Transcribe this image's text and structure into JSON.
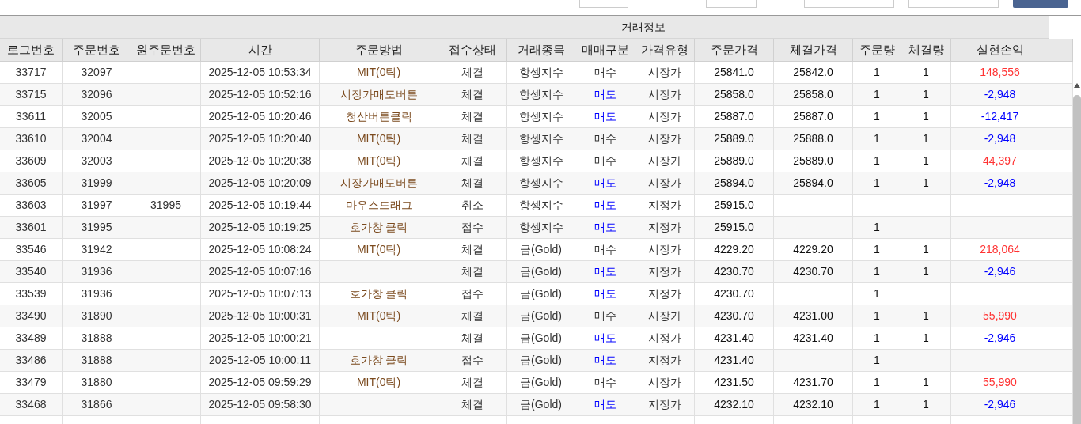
{
  "group_header": "거래정보",
  "columns": [
    "로그번호",
    "주문번호",
    "원주문번호",
    "시간",
    "주문방법",
    "접수상태",
    "거래종목",
    "매매구분",
    "가격유형",
    "주문가격",
    "체결가격",
    "주문량",
    "체결량",
    "실현손익"
  ],
  "rows": [
    {
      "cells": [
        "33717",
        "32097",
        null,
        "2025-12-05 10:53:34",
        "MIT(0틱)",
        "체결",
        "항셍지수",
        {
          "text": "매수",
          "color": "#333333"
        },
        "시장가",
        "25841.0",
        "25842.0",
        "1",
        "1",
        {
          "text": "148,556",
          "color": "#ff3333"
        }
      ]
    },
    {
      "cells": [
        "33715",
        "32096",
        null,
        "2025-12-05 10:52:16",
        "시장가매도버튼",
        "체결",
        "항셍지수",
        {
          "text": "매도",
          "color": "#0000ff"
        },
        "시장가",
        "25858.0",
        "25858.0",
        "1",
        "1",
        {
          "text": "-2,948",
          "color": "#0000ff"
        }
      ]
    },
    {
      "cells": [
        "33611",
        "32005",
        null,
        "2025-12-05 10:20:46",
        "청산버튼클릭",
        "체결",
        "항셍지수",
        {
          "text": "매도",
          "color": "#0000ff"
        },
        "시장가",
        "25887.0",
        "25887.0",
        "1",
        "1",
        {
          "text": "-12,417",
          "color": "#0000ff"
        }
      ]
    },
    {
      "cells": [
        "33610",
        "32004",
        null,
        "2025-12-05 10:20:40",
        "MIT(0틱)",
        "체결",
        "항셍지수",
        {
          "text": "매수",
          "color": "#333333"
        },
        "시장가",
        "25889.0",
        "25888.0",
        "1",
        "1",
        {
          "text": "-2,948",
          "color": "#0000ff"
        }
      ]
    },
    {
      "cells": [
        "33609",
        "32003",
        null,
        "2025-12-05 10:20:38",
        "MIT(0틱)",
        "체결",
        "항셍지수",
        {
          "text": "매수",
          "color": "#333333"
        },
        "시장가",
        "25889.0",
        "25889.0",
        "1",
        "1",
        {
          "text": "44,397",
          "color": "#ff3333"
        }
      ]
    },
    {
      "cells": [
        "33605",
        "31999",
        null,
        "2025-12-05 10:20:09",
        "시장가매도버튼",
        "체결",
        "항셍지수",
        {
          "text": "매도",
          "color": "#0000ff"
        },
        "시장가",
        "25894.0",
        "25894.0",
        "1",
        "1",
        {
          "text": "-2,948",
          "color": "#0000ff"
        }
      ]
    },
    {
      "cells": [
        "33603",
        "31997",
        "31995",
        "2025-12-05 10:19:44",
        "마우스드래그",
        "취소",
        "항셍지수",
        {
          "text": "매도",
          "color": "#0000ff"
        },
        "지정가",
        "25915.0",
        null,
        null,
        null,
        null
      ]
    },
    {
      "cells": [
        "33601",
        "31995",
        null,
        "2025-12-05 10:19:25",
        "호가창 클릭",
        "접수",
        "항셍지수",
        {
          "text": "매도",
          "color": "#0000ff"
        },
        "지정가",
        "25915.0",
        null,
        "1",
        null,
        null
      ]
    },
    {
      "cells": [
        "33546",
        "31942",
        null,
        "2025-12-05 10:08:24",
        "MIT(0틱)",
        "체결",
        "금(Gold)",
        {
          "text": "매수",
          "color": "#333333"
        },
        "시장가",
        "4229.20",
        "4229.20",
        "1",
        "1",
        {
          "text": "218,064",
          "color": "#ff3333"
        }
      ]
    },
    {
      "cells": [
        "33540",
        "31936",
        null,
        "2025-12-05 10:07:16",
        null,
        "체결",
        "금(Gold)",
        {
          "text": "매도",
          "color": "#0000ff"
        },
        "지정가",
        "4230.70",
        "4230.70",
        "1",
        "1",
        {
          "text": "-2,946",
          "color": "#0000ff"
        }
      ]
    },
    {
      "cells": [
        "33539",
        "31936",
        null,
        "2025-12-05 10:07:13",
        "호가창 클릭",
        "접수",
        "금(Gold)",
        {
          "text": "매도",
          "color": "#0000ff"
        },
        "지정가",
        "4230.70",
        null,
        "1",
        null,
        null
      ]
    },
    {
      "cells": [
        "33490",
        "31890",
        null,
        "2025-12-05 10:00:31",
        "MIT(0틱)",
        "체결",
        "금(Gold)",
        {
          "text": "매수",
          "color": "#333333"
        },
        "시장가",
        "4230.70",
        "4231.00",
        "1",
        "1",
        {
          "text": "55,990",
          "color": "#ff3333"
        }
      ]
    },
    {
      "cells": [
        "33489",
        "31888",
        null,
        "2025-12-05 10:00:21",
        null,
        "체결",
        "금(Gold)",
        {
          "text": "매도",
          "color": "#0000ff"
        },
        "지정가",
        "4231.40",
        "4231.40",
        "1",
        "1",
        {
          "text": "-2,946",
          "color": "#0000ff"
        }
      ]
    },
    {
      "cells": [
        "33486",
        "31888",
        null,
        "2025-12-05 10:00:11",
        "호가창 클릭",
        "접수",
        "금(Gold)",
        {
          "text": "매도",
          "color": "#0000ff"
        },
        "지정가",
        "4231.40",
        null,
        "1",
        null,
        null
      ]
    },
    {
      "cells": [
        "33479",
        "31880",
        null,
        "2025-12-05 09:59:29",
        "MIT(0틱)",
        "체결",
        "금(Gold)",
        {
          "text": "매수",
          "color": "#333333"
        },
        "시장가",
        "4231.50",
        "4231.70",
        "1",
        "1",
        {
          "text": "55,990",
          "color": "#ff3333"
        }
      ]
    },
    {
      "cells": [
        "33468",
        "31866",
        null,
        "2025-12-05 09:58:30",
        null,
        "체결",
        "금(Gold)",
        {
          "text": "매도",
          "color": "#0000ff"
        },
        "지정가",
        "4232.10",
        "4232.10",
        "1",
        "1",
        {
          "text": "-2,946",
          "color": "#0000ff"
        }
      ]
    }
  ]
}
